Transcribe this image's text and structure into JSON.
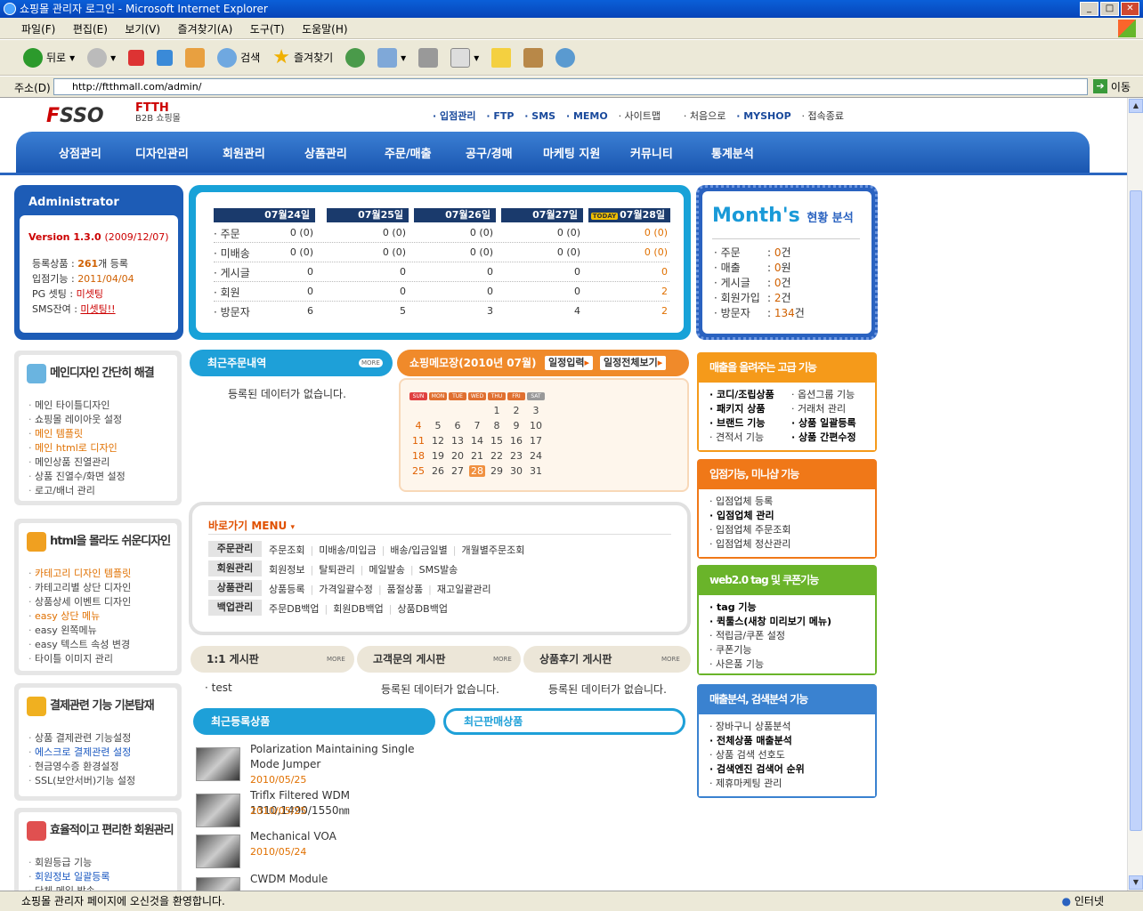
{
  "window": {
    "title": "쇼핑몰 관리자 로그인 - Microsoft Internet Explorer"
  },
  "menubar": [
    "파일(F)",
    "편집(E)",
    "보기(V)",
    "즐겨찾기(A)",
    "도구(T)",
    "도움말(H)"
  ],
  "toolbar": {
    "back": "뒤로",
    "search": "검색",
    "favorites": "즐겨찾기"
  },
  "address": {
    "label": "주소(D)",
    "url": "http://ftthmall.com/admin/",
    "go": "이동"
  },
  "status": {
    "text": "쇼핑몰 관리자 페이지에 오신것을 환영합니다.",
    "zone": "인터넷"
  },
  "header": {
    "logo_prefix": "F",
    "logo_rest": "SSO",
    "brand": "FTTH",
    "brand_sub": "B2B 쇼핑몰",
    "links": [
      "· 입점관리",
      "· FTP",
      "· SMS",
      "· MEMO",
      "· 사이트맵",
      "· 처음으로",
      "· MYSHOP",
      "· 접속종료"
    ]
  },
  "gnb": [
    "상점관리",
    "디자인관리",
    "회원관리",
    "상품관리",
    "주문/매출",
    "공구/경매",
    "마케팅 지원",
    "커뮤니티",
    "통계분석"
  ],
  "admin": {
    "title": "Administrator",
    "version": "Version 1.3.0",
    "version_date": "(2009/12/07)",
    "rows": [
      {
        "label": "등록상품 :",
        "value": "261",
        "suffix": "개 등록"
      },
      {
        "label": "입점기능 :",
        "value": "2011/04/04",
        "suffix": ""
      },
      {
        "label": "PG 셋팅 :",
        "value": "미셋팅",
        "suffix": ""
      },
      {
        "label": "SMS잔여 :",
        "value": "미셋팅!!",
        "suffix": ""
      }
    ]
  },
  "daily": {
    "today_badge": "TODAY",
    "dates": [
      "07월24일",
      "07월25일",
      "07월26일",
      "07월27일",
      "07월28일"
    ],
    "rows": [
      {
        "label": "· 주문",
        "values": [
          "0 (0)",
          "0 (0)",
          "0 (0)",
          "0 (0)",
          "0 (0)"
        ]
      },
      {
        "label": "· 미배송",
        "values": [
          "0 (0)",
          "0 (0)",
          "0 (0)",
          "0 (0)",
          "0 (0)"
        ]
      },
      {
        "label": "· 게시글",
        "values": [
          "0",
          "0",
          "0",
          "0",
          "0"
        ]
      },
      {
        "label": "· 회원",
        "values": [
          "0",
          "0",
          "0",
          "0",
          "2"
        ]
      },
      {
        "label": "· 방문자",
        "values": [
          "6",
          "5",
          "3",
          "4",
          "2"
        ]
      }
    ]
  },
  "month": {
    "title": "Month's",
    "subtitle": "현황 분석",
    "rows": [
      {
        "label": "· 주문",
        "value": "0",
        "unit": "건"
      },
      {
        "label": "· 매출",
        "value": "0",
        "unit": "원"
      },
      {
        "label": "· 게시글",
        "value": "0",
        "unit": "건"
      },
      {
        "label": "· 회원가입",
        "value": "2",
        "unit": "건"
      },
      {
        "label": "· 방문자",
        "value": "134",
        "unit": "건"
      }
    ]
  },
  "left_panels": [
    {
      "title": "메인디자인 간단히 해결",
      "items": [
        {
          "text": "메인 타이틀디자인",
          "c": ""
        },
        {
          "text": "쇼핑몰 레이아웃 설정",
          "c": ""
        },
        {
          "text": "메인 템플릿",
          "c": "o"
        },
        {
          "text": "메인 html로 디자인",
          "c": "o"
        },
        {
          "text": "메인상품 진열관리",
          "c": ""
        },
        {
          "text": "상품 진열수/화면 설정",
          "c": ""
        },
        {
          "text": "로고/배너 관리",
          "c": ""
        }
      ]
    },
    {
      "title": "html을 몰라도 쉬운디자인",
      "items": [
        {
          "text": "카테고리 디자인 템플릿",
          "c": "o"
        },
        {
          "text": "카테고리별 상단 디자인",
          "c": ""
        },
        {
          "text": "상품상세 이벤트 디자인",
          "c": ""
        },
        {
          "text": "easy 상단 메뉴",
          "c": "o"
        },
        {
          "text": "easy 왼쪽메뉴",
          "c": ""
        },
        {
          "text": "easy 텍스트 속성 변경",
          "c": ""
        },
        {
          "text": "타이틀 이미지 관리",
          "c": ""
        }
      ]
    },
    {
      "title": "결제관련 기능 기본탑재",
      "items": [
        {
          "text": "상품 결제관련 기능설정",
          "c": ""
        },
        {
          "text": "에스크로 결제관련 설정",
          "c": "b"
        },
        {
          "text": "현금영수증 환경설정",
          "c": ""
        },
        {
          "text": "SSL(보안서버)기능 설정",
          "c": ""
        }
      ]
    },
    {
      "title": "효율적이고 편리한 회원관리",
      "items": [
        {
          "text": "회원등급 기능",
          "c": ""
        },
        {
          "text": "회원정보 일괄등록",
          "c": "b"
        },
        {
          "text": "단체 메일 발송",
          "c": ""
        }
      ]
    }
  ],
  "recent_orders": {
    "title": "최근주문내역",
    "more": "MORE",
    "empty": "등록된 데이터가 없습니다."
  },
  "memo": {
    "title": "쇼핑메모장(2010년 07월)",
    "btn_input": "일정입력",
    "btn_all": "일정전체보기",
    "dow": [
      "SUN",
      "MON",
      "TUE",
      "WED",
      "THU",
      "FRI",
      "SAT"
    ],
    "weeks": [
      [
        "",
        "",
        "",
        "",
        "1",
        "2",
        "3"
      ],
      [
        "4",
        "5",
        "6",
        "7",
        "8",
        "9",
        "10"
      ],
      [
        "11",
        "12",
        "13",
        "14",
        "15",
        "16",
        "17"
      ],
      [
        "18",
        "19",
        "20",
        "21",
        "22",
        "23",
        "24"
      ],
      [
        "25",
        "26",
        "27",
        "28",
        "29",
        "30",
        "31"
      ]
    ],
    "today": "28"
  },
  "quick": {
    "title": "바로가기 MENU",
    "rows": [
      {
        "tag": "주문관리",
        "items": [
          "주문조회",
          "미배송/미입금",
          "배송/입금일별",
          "개월별주문조회"
        ]
      },
      {
        "tag": "회원관리",
        "items": [
          "회원정보",
          "탈퇴관리",
          "메일발송",
          "SMS발송"
        ]
      },
      {
        "tag": "상품관리",
        "items": [
          "상품등록",
          "가격일괄수정",
          "품절상품",
          "재고일괄관리"
        ]
      },
      {
        "tag": "백업관리",
        "items": [
          "주문DB백업",
          "회원DB백업",
          "상품DB백업"
        ]
      }
    ]
  },
  "boards": [
    {
      "title": "1:1 게시판",
      "more": "MORE",
      "content": "· test"
    },
    {
      "title": "고객문의 게시판",
      "more": "MORE",
      "content": "등록된 데이터가 없습니다."
    },
    {
      "title": "상품후기 게시판",
      "more": "MORE",
      "content": "등록된 데이터가 없습니다."
    }
  ],
  "products_tabs": {
    "recent_reg": "최근등록상품",
    "recent_sold": "최근판매상품"
  },
  "products": [
    {
      "name": "Polarization Maintaining Single Mode Jumper",
      "date": "2010/05/25"
    },
    {
      "name": "Triflx Filtered WDM 1310,1490/1550㎚",
      "date": "2010/05/25"
    },
    {
      "name": "Mechanical VOA",
      "date": "2010/05/24"
    },
    {
      "name": "CWDM Module",
      "date": ""
    }
  ],
  "right_boxes": [
    {
      "title": "매출을 올려주는 고급 기능",
      "color": "#f59a1a",
      "col1": [
        "코디/조립상품",
        "패키지 상품",
        "브랜드 기능",
        "견적서 기능"
      ],
      "col1_bold": [
        true,
        true,
        true,
        false
      ],
      "col2": [
        "옵션그룹 기능",
        "거래처 관리",
        "상품 일괄등록",
        "상품 간편수정"
      ],
      "col2_bold": [
        false,
        false,
        true,
        true
      ]
    },
    {
      "title": "입점기능, 미니샵 기능",
      "color": "#f07818",
      "col1": [
        "입점업체 등록",
        "입점업체 관리",
        "입점업체 주문조회",
        "입점업체 정산관리"
      ],
      "col1_bold": [
        false,
        true,
        false,
        false
      ]
    },
    {
      "title": "web2.0 tag 및 쿠폰기능",
      "color": "#6ab42a",
      "col1": [
        "tag 기능",
        "퀵툴스(새창 미리보기 메뉴)",
        "적립금/쿠폰 설정",
        "쿠폰기능",
        "사은품 기능"
      ],
      "col1_bold": [
        true,
        true,
        false,
        false,
        false
      ]
    },
    {
      "title": "매출분석, 검색분석 기능",
      "color": "#3a82d0",
      "col1": [
        "장바구니 상품분석",
        "전체상품 매출분석",
        "상품 검색 선호도",
        "검색엔진 검색어 순위",
        "제휴마케팅 관리"
      ],
      "col1_bold": [
        false,
        true,
        false,
        true,
        false
      ]
    }
  ]
}
